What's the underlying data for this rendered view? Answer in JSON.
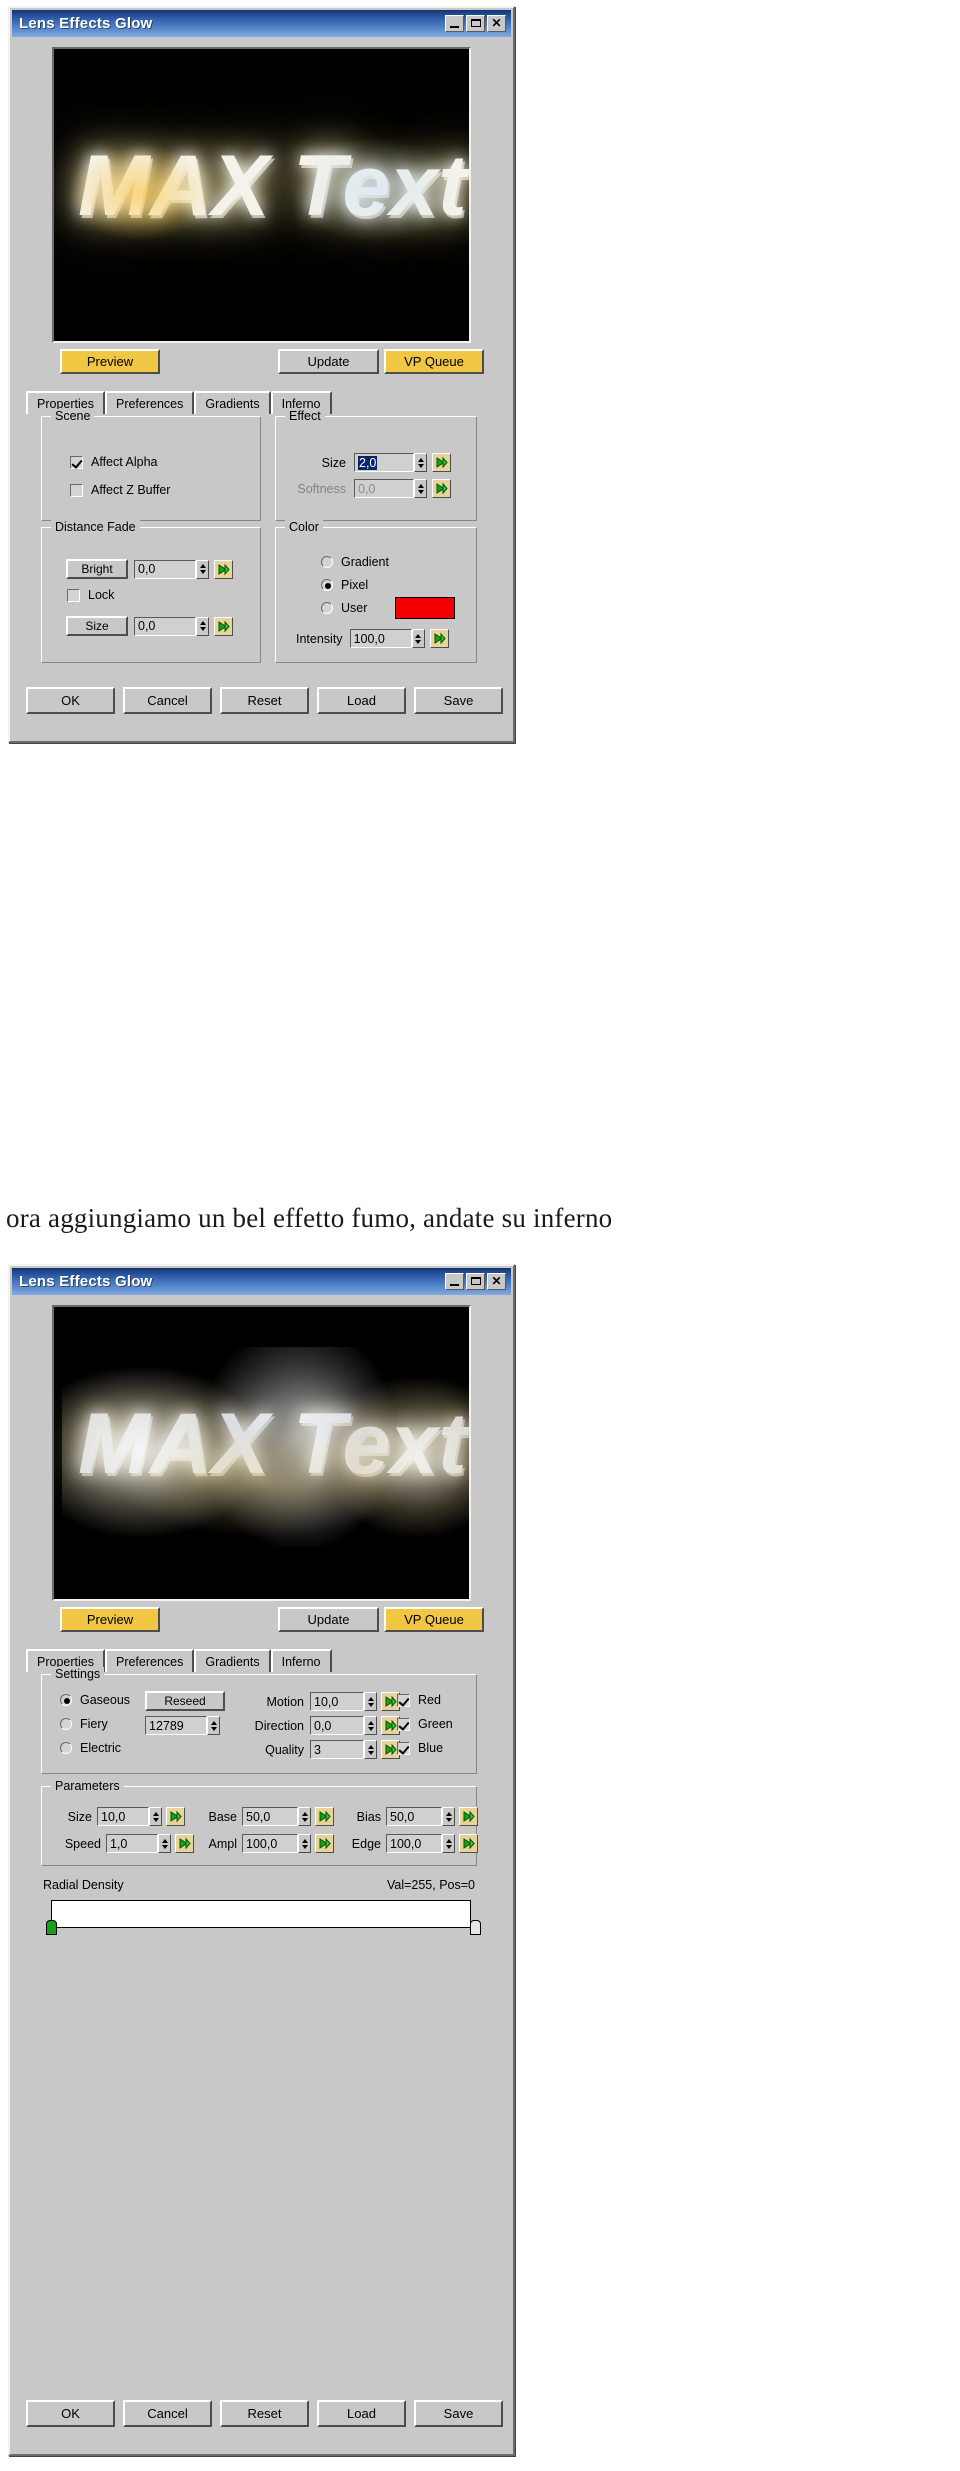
{
  "page": {
    "caption": "ora aggiungiamo un bel effetto fumo, andate su inferno"
  },
  "colors": {
    "titlebar_dark": "#14356e",
    "titlebar_light": "#86aade",
    "dialog_face": "#c8c8c8",
    "highlight_button": "#f0c642",
    "user_color_swatch": "#f20000",
    "field_selection": "#0a246a",
    "gradient_key_green": "#18a018"
  },
  "dialog1": {
    "title": "Lens Effects Glow",
    "window_buttons": [
      {
        "name": "minimize",
        "glyph": "_"
      },
      {
        "name": "maximize",
        "glyph": "□"
      },
      {
        "name": "close",
        "glyph": "✕"
      }
    ],
    "preview_label": "MAX Text",
    "action_buttons": [
      {
        "label": "Preview",
        "style": "gold"
      },
      {
        "label": "Update",
        "style": "normal"
      },
      {
        "label": "VP Queue",
        "style": "gold"
      }
    ],
    "tabs": [
      {
        "label": "Properties",
        "active": true
      },
      {
        "label": "Preferences",
        "active": false
      },
      {
        "label": "Gradients",
        "active": false
      },
      {
        "label": "Inferno",
        "active": false
      }
    ],
    "scene": {
      "title": "Scene",
      "checks": [
        {
          "label": "Affect Alpha",
          "checked": true
        },
        {
          "label": "Affect Z Buffer",
          "checked": false
        }
      ]
    },
    "effect": {
      "title": "Effect",
      "rows": [
        {
          "label": "Size",
          "value": "2,0",
          "selected": true,
          "disabled": false
        },
        {
          "label": "Softness",
          "value": "0,0",
          "selected": false,
          "disabled": true
        }
      ]
    },
    "distance_fade": {
      "title": "Distance Fade",
      "bright_label": "Bright",
      "bright_value": "0,0",
      "lock_label": "Lock",
      "lock_checked": false,
      "size_label": "Size",
      "size_value": "0,0"
    },
    "color": {
      "title": "Color",
      "options": [
        {
          "label": "Gradient",
          "selected": false
        },
        {
          "label": "Pixel",
          "selected": true
        },
        {
          "label": "User",
          "selected": false
        }
      ],
      "swatch": "#f20000",
      "intensity_label": "Intensity",
      "intensity_value": "100,0"
    },
    "footer_buttons": [
      "OK",
      "Cancel",
      "Reset",
      "Load",
      "Save"
    ]
  },
  "dialog2": {
    "title": "Lens Effects Glow",
    "window_buttons": [
      {
        "name": "minimize",
        "glyph": "_"
      },
      {
        "name": "maximize",
        "glyph": "□"
      },
      {
        "name": "close",
        "glyph": "✕"
      }
    ],
    "preview_label": "MAX Text",
    "action_buttons": [
      {
        "label": "Preview",
        "style": "gold"
      },
      {
        "label": "Update",
        "style": "normal"
      },
      {
        "label": "VP Queue",
        "style": "gold"
      }
    ],
    "tabs": [
      {
        "label": "Properties",
        "active": false
      },
      {
        "label": "Preferences",
        "active": false
      },
      {
        "label": "Gradients",
        "active": false
      },
      {
        "label": "Inferno",
        "active": true
      }
    ],
    "settings": {
      "title": "Settings",
      "types": [
        {
          "label": "Gaseous",
          "selected": true
        },
        {
          "label": "Fiery",
          "selected": false
        },
        {
          "label": "Electric",
          "selected": false
        }
      ],
      "reseed_label": "Reseed",
      "seed_value": "12789",
      "fields": [
        {
          "label": "Motion",
          "value": "10,0"
        },
        {
          "label": "Direction",
          "value": "0,0"
        },
        {
          "label": "Quality",
          "value": "3"
        }
      ],
      "channels": [
        {
          "label": "Red",
          "checked": true
        },
        {
          "label": "Green",
          "checked": true
        },
        {
          "label": "Blue",
          "checked": true
        }
      ]
    },
    "parameters": {
      "title": "Parameters",
      "row1": [
        {
          "label": "Size",
          "value": "10,0"
        },
        {
          "label": "Base",
          "value": "50,0"
        },
        {
          "label": "Bias",
          "value": "50,0"
        }
      ],
      "row2": [
        {
          "label": "Speed",
          "value": "1,0"
        },
        {
          "label": "Ampl",
          "value": "100,0"
        },
        {
          "label": "Edge",
          "value": "100,0"
        }
      ]
    },
    "radial_density": {
      "label": "Radial Density",
      "readout": "Val=255, Pos=0"
    },
    "footer_buttons": [
      "OK",
      "Cancel",
      "Reset",
      "Load",
      "Save"
    ]
  }
}
